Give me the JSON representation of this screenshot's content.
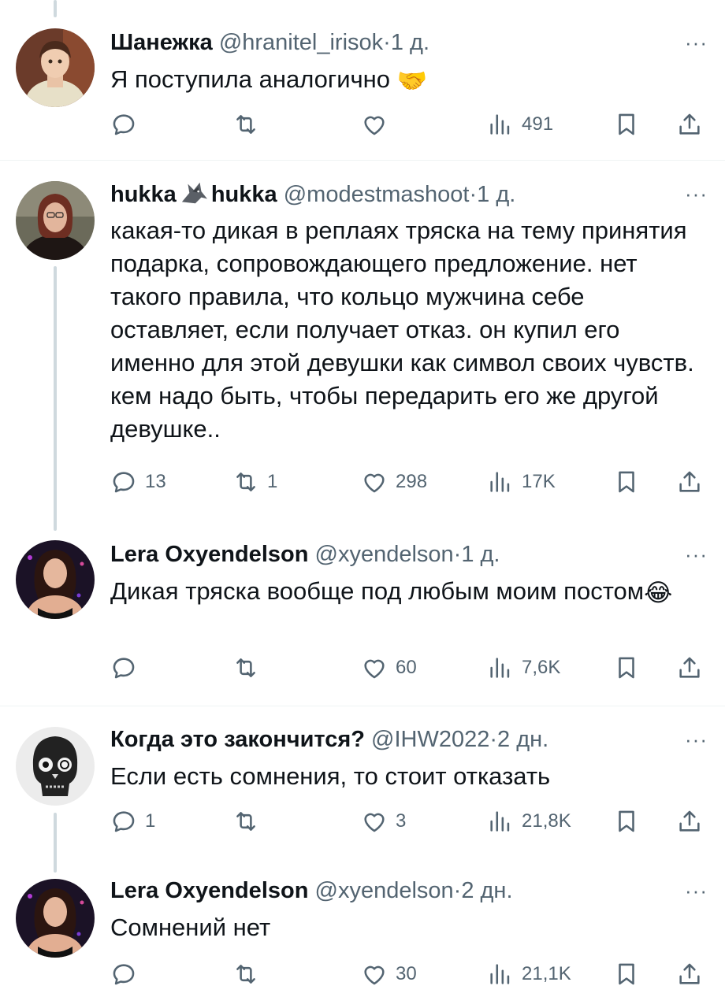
{
  "tweets": [
    {
      "name": "Шанежка",
      "handle": "@hranitel_irisok",
      "time": "1 д.",
      "text": "Я поступила аналогично",
      "emoji": "🤝",
      "replies": "",
      "retweets": "",
      "likes": "",
      "views": "491"
    },
    {
      "name": "hukka",
      "name2": "hukka",
      "handle": "@modestmashoot",
      "time": "1 д.",
      "text": "какая-то дикая в реплаях тряска на тему принятия подарка, сопровождающего предложение. нет такого правила, что кольцо мужчина себе оставляет, если получает отказ. он купил его именно для этой девушки как символ своих чувств. кем надо быть, чтобы передарить его же другой девушке..",
      "replies": "13",
      "retweets": "1",
      "likes": "298",
      "views": "17K"
    },
    {
      "name": "Lera Oxyendelson",
      "handle": "@xyendelson",
      "time": "1 д.",
      "text": "Дикая тряска вообще под любым моим постом",
      "emoji": "😂",
      "replies": "",
      "retweets": "",
      "likes": "60",
      "views": "7,6K"
    },
    {
      "name": "Когда это закончится?",
      "handle": "@IHW2022",
      "time": "2 дн.",
      "text": "Если есть сомнения, то стоит отказать",
      "replies": "1",
      "retweets": "",
      "likes": "3",
      "views": "21,8K"
    },
    {
      "name": "Lera Oxyendelson",
      "handle": "@xyendelson",
      "time": "2 дн.",
      "text": "Сомнений нет",
      "replies": "",
      "retweets": "",
      "likes": "30",
      "views": "21,1K"
    }
  ],
  "separator": "·",
  "more_label": "···",
  "colors": {
    "text": "#0f1419",
    "secondary": "#536471",
    "thread_line": "#cfd9de",
    "divider": "#eff3f4"
  },
  "icons": [
    "reply-icon",
    "retweet-icon",
    "like-icon",
    "views-icon",
    "bookmark-icon",
    "share-icon",
    "more-icon",
    "wolf-icon"
  ]
}
